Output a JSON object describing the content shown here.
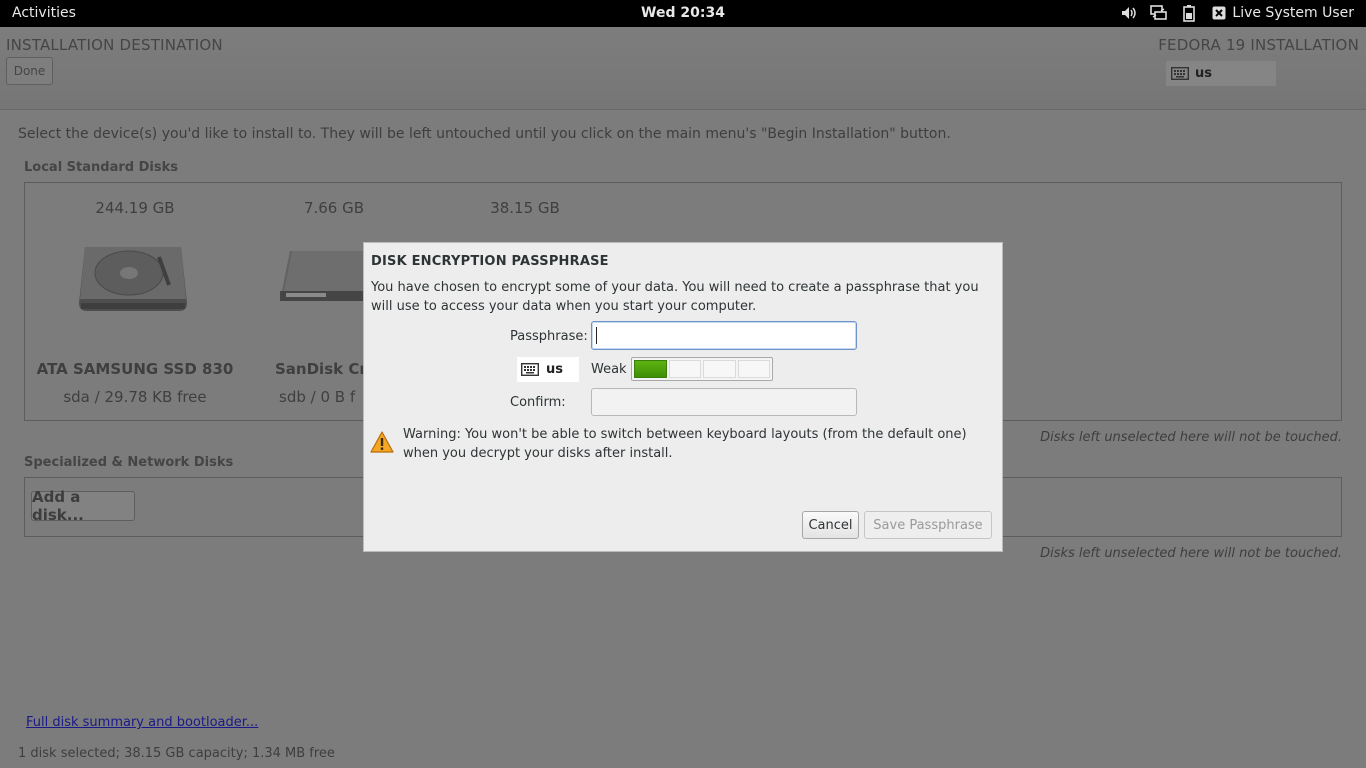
{
  "topbar": {
    "activities": "Activities",
    "clock": "Wed 20:34",
    "icons": [
      "volume-icon",
      "network-icon",
      "battery-icon",
      "accessibility-icon"
    ],
    "user": "Live System User"
  },
  "header": {
    "title": "INSTALLATION DESTINATION",
    "done_label": "Done",
    "product": "FEDORA 19 INSTALLATION",
    "keyboard_layout": "us"
  },
  "main": {
    "instructions": "Select the device(s) you'd like to install to.  They will be left untouched until you click on the main menu's \"Begin Installation\" button.",
    "local_disks_label": "Local Standard Disks",
    "disks": [
      {
        "size": "244.19 GB",
        "name": "ATA SAMSUNG SSD 830",
        "info": "sda   /   29.78 KB free"
      },
      {
        "size": "7.66 GB",
        "name": "SanDisk Cru",
        "info": "sdb   /   0 B f"
      },
      {
        "size": "38.15 GB"
      }
    ],
    "untouched_note": "Disks left unselected here will not be touched.",
    "network_disks_label": "Specialized & Network Disks",
    "add_disk_label": "Add a disk...",
    "network_note": "Disks left unselected here will not be touched.",
    "summary_link": "Full disk summary and bootloader...",
    "status": "1 disk selected; 38.15 GB capacity; 1.34 MB free"
  },
  "dialog": {
    "title": "DISK ENCRYPTION PASSPHRASE",
    "description": "You have chosen to encrypt some of your data. You will need to create a passphrase that you will use to access your data when you start your computer.",
    "passphrase_label": "Passphrase:",
    "passphrase_value": "",
    "layout": "us",
    "strength_label": "Weak",
    "strength_level": 1,
    "strength_segments": 4,
    "strength_color": "#4ea10c",
    "confirm_label": "Confirm:",
    "confirm_value": "",
    "warning": "Warning: You won't be able to switch between keyboard layouts (from the default one) when you decrypt your disks after install.",
    "cancel_label": "Cancel",
    "save_label": "Save Passphrase"
  }
}
